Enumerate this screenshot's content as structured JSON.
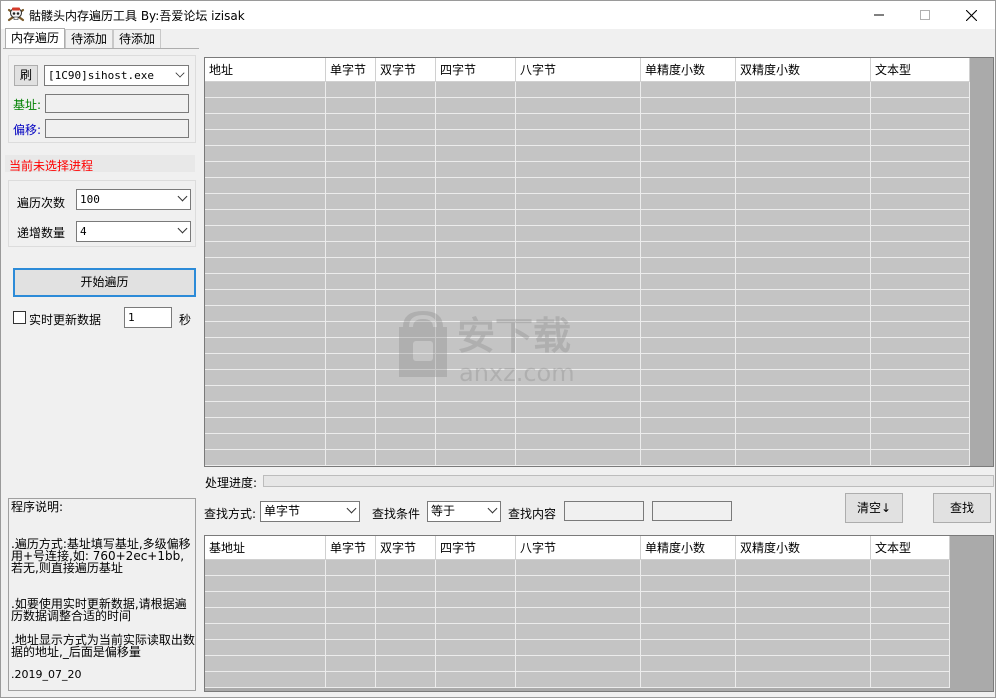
{
  "window": {
    "title": "骷髅头内存遍历工具 By:吾爱论坛 izisak",
    "controls": {
      "minimize": "—",
      "maximize": "☐",
      "close": "✕"
    }
  },
  "tabs": [
    "内存遍历",
    "待添加",
    "待添加"
  ],
  "process": {
    "refresh_label": "刷",
    "selected": "[1C90]sihost.exe",
    "base_label": "基址:",
    "offset_label": "偏移:",
    "base_value": "",
    "offset_value": "",
    "status": "当前未选择进程"
  },
  "traverse": {
    "count_label": "遍历次数",
    "count_value": "100",
    "step_label": "递增数量",
    "step_value": "4",
    "start_button": "开始遍历",
    "realtime_label": "实时更新数据",
    "realtime_checked": false,
    "interval_value": "1",
    "interval_unit": "秒"
  },
  "info": {
    "title": "程序说明:",
    "p1": ".遍历方式:基址填写基址,多级偏移用+号连接,如: 760+2ec+1bb,若无,则直接遍历基址",
    "p2": ".如要使用实时更新数据,请根据遍历数据调整合适的时间",
    "p3": ".地址显示方式为当前实际读取出数据的地址,_后面是偏移量",
    "date": ".2019_07_20"
  },
  "top_grid": {
    "columns": [
      "地址",
      "单字节",
      "双字节",
      "四字节",
      "八字节",
      "单精度小数",
      "双精度小数",
      "文本型"
    ]
  },
  "progress": {
    "label": "处理进度:",
    "value": 0
  },
  "search": {
    "mode_label": "查找方式:",
    "mode_value": "单字节",
    "cond_label": "查找条件",
    "cond_value": "等于",
    "content_label": "查找内容",
    "content_value": "",
    "content_value2": "",
    "clear_button": "清空↓",
    "find_button": "查找"
  },
  "bottom_grid": {
    "columns": [
      "基地址",
      "单字节",
      "双字节",
      "四字节",
      "八字节",
      "单精度小数",
      "双精度小数",
      "文本型"
    ]
  },
  "watermark": {
    "text1": "安下载",
    "text2": "anxz.com"
  },
  "colors": {
    "base_label": "#008000",
    "offset_label": "#0000c0",
    "status_text": "#ff0000",
    "accent": "#2c8bd8"
  }
}
